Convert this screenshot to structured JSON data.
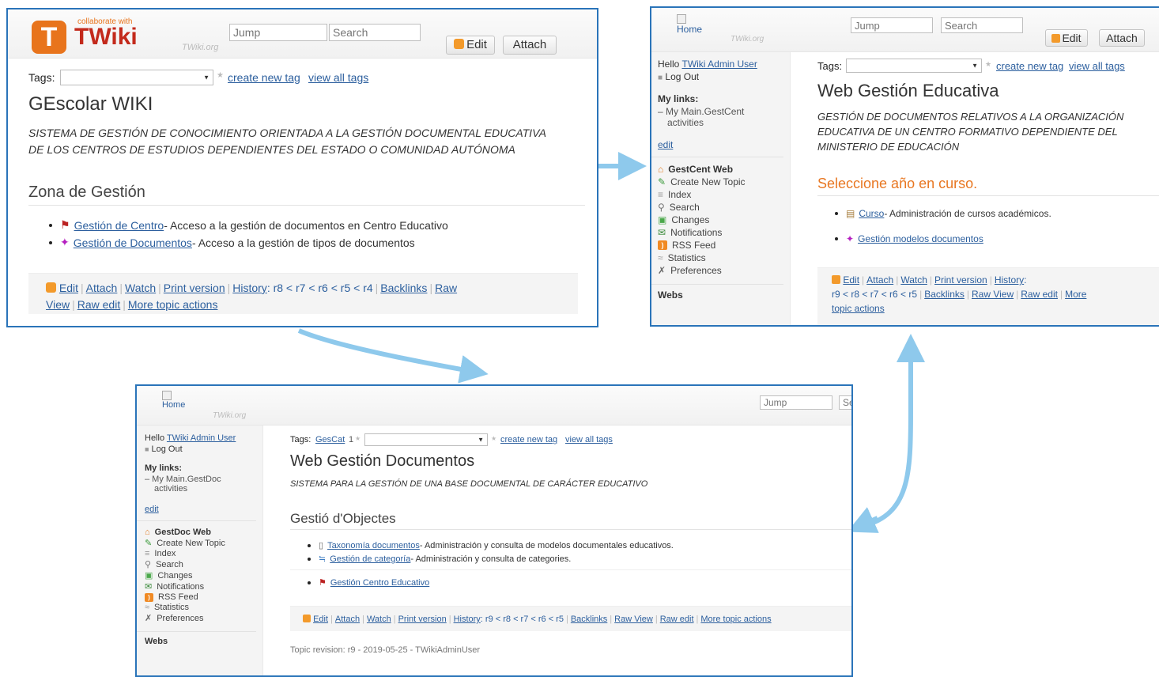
{
  "colors": {
    "border": "#2a74b9",
    "link": "#2c5f9e",
    "arrow": "#8ec9ec",
    "h2_orange": "#e87722",
    "toolbar_bg": "#f4f4f4"
  },
  "panel1": {
    "logo_small": "collaborate with",
    "logo_text": "TWiki",
    "twiki_org": "TWiki.org",
    "jump_placeholder": "Jump",
    "search_placeholder": "Search",
    "edit_label": "Edit",
    "attach_label": "Attach",
    "tags_label": "Tags:",
    "create_tag": "create new tag",
    "view_tags": "view all tags",
    "title": "GEscolar WIKI",
    "desc_line1": "SISTEMA DE GESTIÓN DE CONOCIMIENTO ORIENTADA A LA GESTIÓN DOCUMENTAL EDUCATIVA",
    "desc_line2": "DE LOS CENTROS DE ESTUDIOS DEPENDIENTES DEL ESTADO O COMUNIDAD AUTÓNOMA",
    "section": "Zona de Gestión",
    "items": [
      {
        "link": "Gestión de Centro",
        "text": " - Acceso a la gestión de documentos en Centro Educativo"
      },
      {
        "link": "Gestión de Documentos",
        "text": " - Acceso a la gestión de tipos de documentos"
      }
    ],
    "toolbar": {
      "edit": "Edit",
      "attach": "Attach",
      "watch": "Watch",
      "print": "Print version",
      "history": "History",
      "history_tail": ": r8 < r7 < r6 < r5 < r4",
      "backlinks": "Backlinks",
      "raw": "Raw",
      "view": "View",
      "raw_edit": "Raw edit",
      "more": "More topic actions"
    }
  },
  "panel2": {
    "home": "Home",
    "twiki_org": "TWiki.org",
    "jump_placeholder": "Jump",
    "search_placeholder": "Search",
    "edit_label": "Edit",
    "attach_label": "Attach",
    "hello": "Hello",
    "user": "TWiki Admin User",
    "logout": "Log Out",
    "mylinks": "My links:",
    "mylinks_item1": "– My Main.GestCent",
    "mylinks_item2": "activities",
    "edit_side": "edit",
    "web_name": "GestCent Web",
    "side_items": [
      "Create New Topic",
      "Index",
      "Search",
      "Changes",
      "Notifications",
      "RSS Feed",
      "Statistics",
      "Preferences"
    ],
    "webs": "Webs",
    "tags_label": "Tags:",
    "create_tag": "create new tag",
    "view_tags": "view all tags",
    "title": "Web Gestión Educativa",
    "desc_line1": "GESTIÓN DE DOCUMENTOS RELATIVOS A LA ORGANIZACIÓN",
    "desc_line2": "EDUCATIVA DE UN CENTRO FORMATIVO DEPENDIENTE DEL",
    "desc_line3": "MINISTERIO DE EDUCACIÓN",
    "section": "Seleccione año en curso.",
    "items": [
      {
        "link": "Curso",
        "text": " - Administración de cursos académicos."
      },
      {
        "link": "Gestión modelos documentos",
        "text": ""
      }
    ],
    "toolbar": {
      "edit": "Edit",
      "attach": "Attach",
      "watch": "Watch",
      "print": "Print version",
      "history": "History",
      "history_line2": "r9 < r8 < r7 < r6 < r5",
      "backlinks": "Backlinks",
      "raw_view": "Raw View",
      "raw_edit": "Raw edit",
      "more": "More",
      "topic_actions": "topic actions"
    }
  },
  "panel3": {
    "home": "Home",
    "twiki_org": "TWiki.org",
    "jump_placeholder": "Jump",
    "search_placeholder": "Se",
    "hello": "Hello",
    "user": "TWiki Admin User",
    "logout": "Log Out",
    "mylinks": "My links:",
    "mylinks_item1": "– My Main.GestDoc",
    "mylinks_item2": "activities",
    "edit_side": "edit",
    "web_name": "GestDoc Web",
    "side_items": [
      "Create New Topic",
      "Index",
      "Search",
      "Changes",
      "Notifications",
      "RSS Feed",
      "Statistics",
      "Preferences"
    ],
    "webs": "Webs",
    "tags_label": "Tags:",
    "tag_value": "GesCat",
    "tag_count": "1",
    "create_tag": "create new tag",
    "view_tags": "view all tags",
    "title": "Web Gestión Documentos",
    "desc": "SISTEMA PARA LA GESTIÓN DE UNA BASE DOCUMENTAL DE CARÁCTER EDUCATIVO",
    "section": "Gestió d'Objectes",
    "items": [
      {
        "link": "Taxonomía documentos",
        "text": " - Administración y consulta de modelos documentales educativos."
      },
      {
        "link": "Gestión de categoría",
        "text": " - Administración y consulta de categories."
      },
      {
        "link": "Gestión Centro Educativo",
        "text": ""
      }
    ],
    "toolbar": {
      "edit": "Edit",
      "attach": "Attach",
      "watch": "Watch",
      "print": "Print version",
      "history": "History",
      "history_tail": ": r9 < r8 < r7 < r6 < r5",
      "backlinks": "Backlinks",
      "raw_view": "Raw View",
      "raw_edit": "Raw edit",
      "more": "More topic actions"
    },
    "revision": "Topic revision: r9 - 2019-05-25 - TWikiAdminUser"
  }
}
